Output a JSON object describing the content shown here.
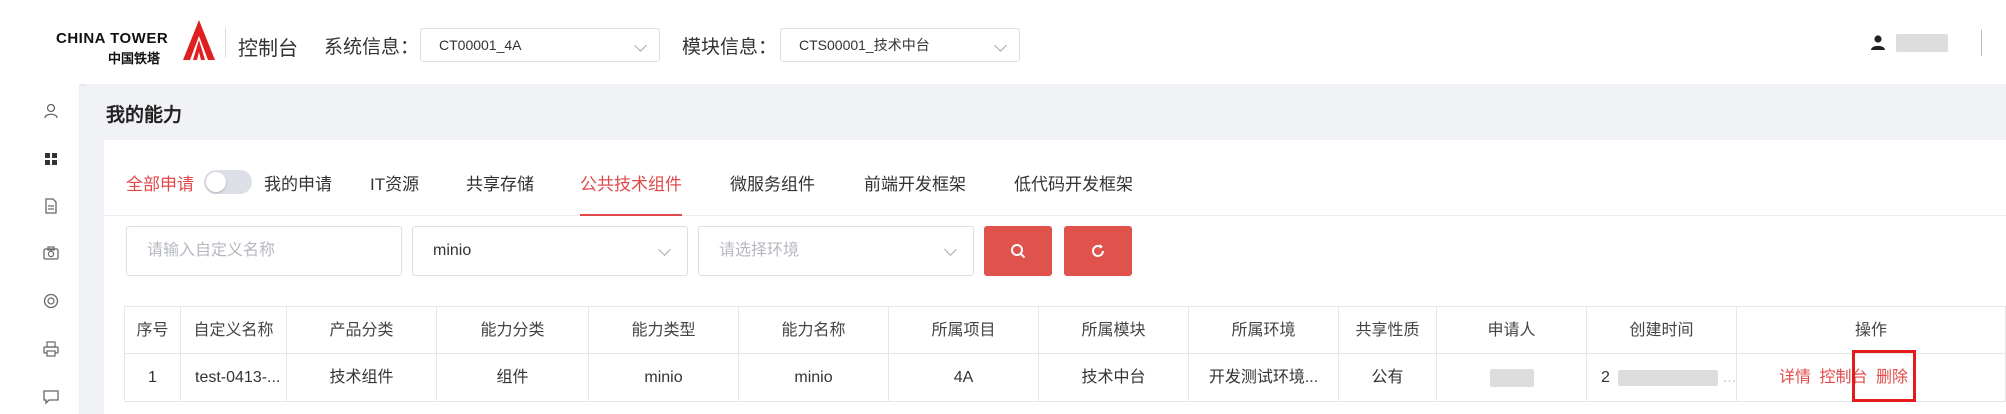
{
  "header": {
    "logo_en": "CHINA TOWER",
    "logo_cn": "中国铁塔",
    "console_title": "控制台",
    "system_label": "系统信息：",
    "system_value": "CT00001_4A",
    "module_label": "模块信息：",
    "module_value": "CTS00001_技术中台"
  },
  "page": {
    "title": "我的能力"
  },
  "filters_tabs": {
    "all_label": "全部申请",
    "mine_label": "我的申请",
    "tabs": [
      "IT资源",
      "共享存储",
      "公共技术组件",
      "微服务组件",
      "前端开发框架",
      "低代码开发框架"
    ],
    "active_tab": "公共技术组件"
  },
  "search": {
    "name_placeholder": "请输入自定义名称",
    "component_value": "minio",
    "env_placeholder": "请选择环境"
  },
  "table": {
    "headers": [
      "序号",
      "自定义名称",
      "产品分类",
      "能力分类",
      "能力类型",
      "能力名称",
      "所属项目",
      "所属模块",
      "所属环境",
      "共享性质",
      "申请人",
      "创建时间",
      "操作"
    ],
    "rows": [
      {
        "index": "1",
        "custom_name": "test-0413-...",
        "product_category": "技术组件",
        "capability_category": "组件",
        "capability_type": "minio",
        "capability_name": "minio",
        "project": "4A",
        "module": "技术中台",
        "environment": "开发测试环境...",
        "share_type": "公有",
        "created_prefix": "2",
        "ops": [
          "详情",
          "控制台",
          "删除"
        ]
      }
    ]
  },
  "colors": {
    "accent": "#e04a4a",
    "highlight": "#e21b1b"
  }
}
